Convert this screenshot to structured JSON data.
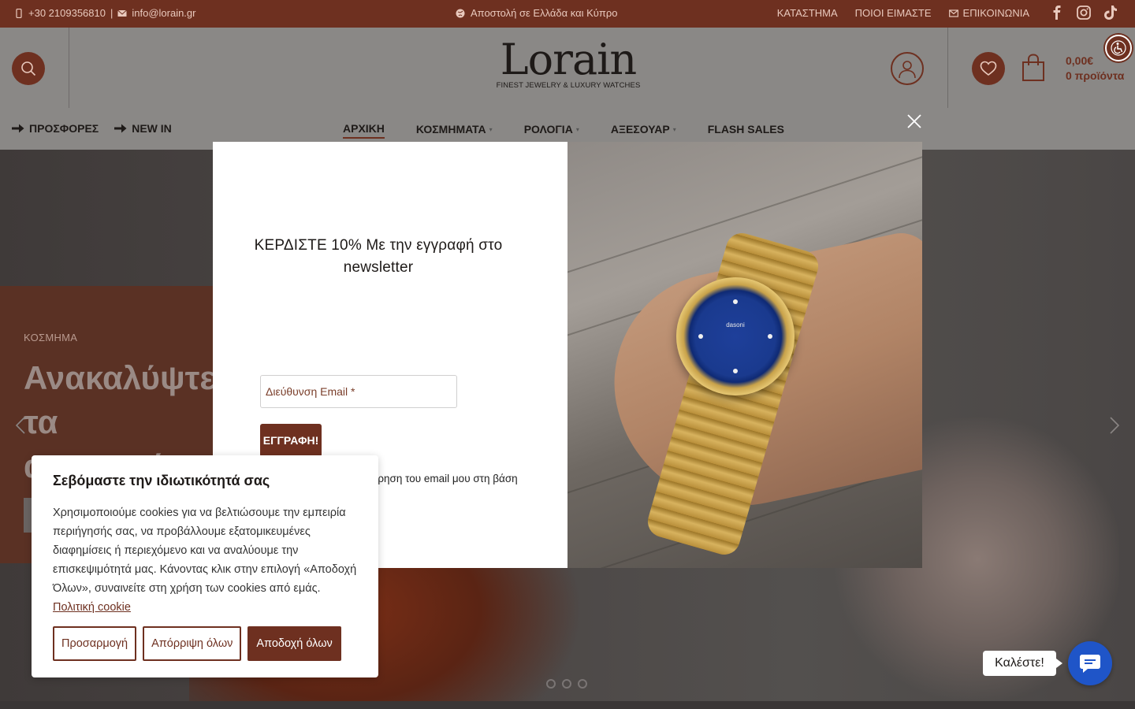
{
  "topbar": {
    "phone": "+30 2109356810",
    "separator": "|",
    "email": "info@lorain.gr",
    "shipping": "Αποστολή σε Ελλάδα και Κύπρο",
    "links": [
      "ΚΑΤΑΣΤΗΜΑ",
      "ΠΟΙΟΙ ΕΙΜΑΣΤΕ",
      "ΕΠΙΚΟΙΝΩΝΙΑ"
    ],
    "social": [
      "facebook-icon",
      "instagram-icon",
      "tiktok-icon"
    ]
  },
  "header": {
    "logo_word": "Lorain",
    "logo_tagline": "FINEST JEWELRY & LUXURY WATCHES",
    "cart_total": "0,00€",
    "cart_count": "0 προϊόντα"
  },
  "nav_left": [
    "ΠΡΟΣΦΟΡΕΣ",
    "NEW IN"
  ],
  "nav_main": [
    {
      "label": "ΑΡΧΙΚΗ",
      "active": true,
      "has_caret": false
    },
    {
      "label": "ΚΟΣΜΗΜΑΤΑ",
      "has_caret": true
    },
    {
      "label": "ΡΟΛΟΓΙΑ",
      "has_caret": true
    },
    {
      "label": "ΑΞΕΣΟΥΑΡ",
      "has_caret": true
    },
    {
      "label": "FLASH SALES",
      "has_caret": false
    }
  ],
  "hero": {
    "category": "ΚΟΣΜΗΜΑ",
    "headline": "Ανακαλύψτε τα αγαπημένα σας κοσμήματα",
    "slide_count": 3
  },
  "modal": {
    "title": "ΚΕΡΔΙΣΤΕ 10% Με την εγγραφή στο newsletter",
    "email_placeholder": "Διεύθυνση Email *",
    "submit_label": "ΕΓΓΡΑΦΗ!",
    "consent_text": "Συμφωνώ με την καταχώρηση του email μου στη βάση",
    "watch_brand": "dasoni"
  },
  "cookie": {
    "title": "Σεβόμαστε την ιδιωτικότητά σας",
    "text": "Χρησιμοποιούμε cookies για να βελτιώσουμε την εμπειρία περιήγησής σας, να προβάλλουμε εξατομικευμένες διαφημίσεις ή περιεχόμενο και να αναλύουμε την επισκεψιμότητά μας. Κάνοντας κλικ στην επιλογή «Αποδοχή Όλων», συναινείτε στη χρήση των cookies από εμάς.",
    "policy_link": "Πολιτική cookie",
    "customize": "Προσαρμογή",
    "reject": "Απόρριψη όλων",
    "accept": "Αποδοχή όλων"
  },
  "call_widget": {
    "label": "Καλέστε!"
  },
  "colors": {
    "brand": "#6e3020",
    "call_blue": "#1f55c8"
  }
}
